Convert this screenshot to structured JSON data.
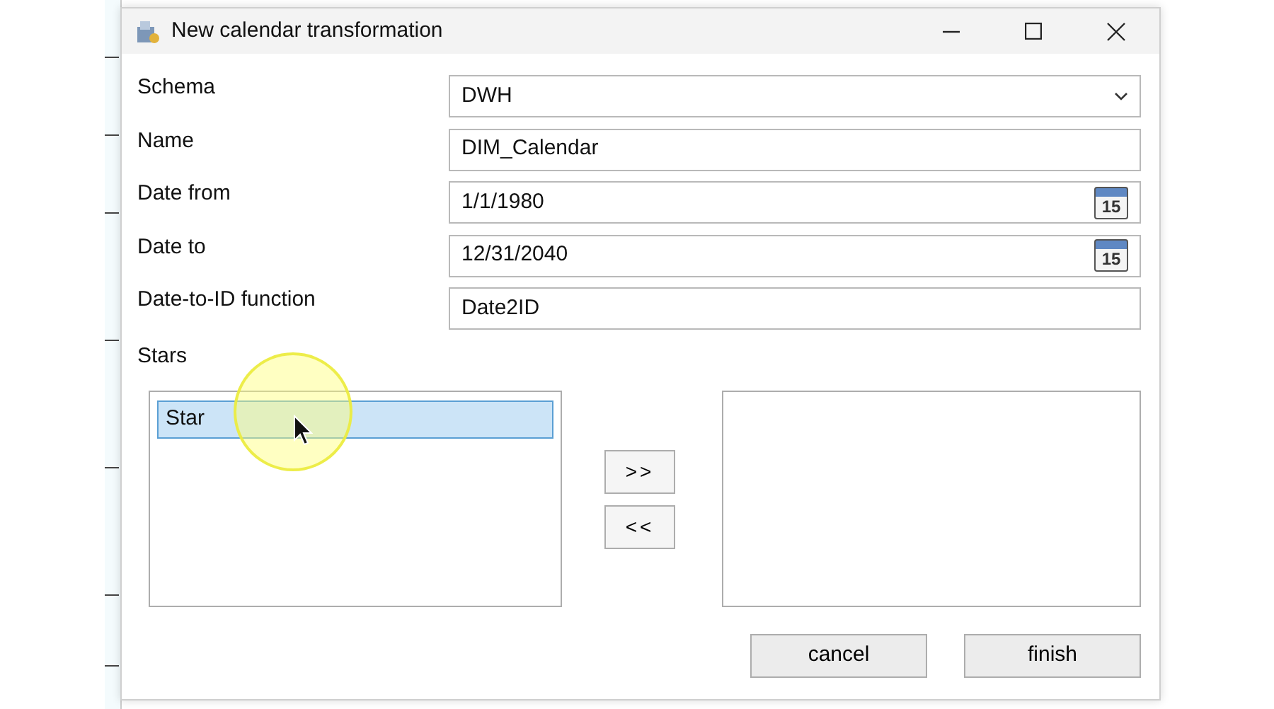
{
  "window": {
    "title": "New calendar transformation"
  },
  "fields": [
    {
      "label": "Schema",
      "kind": "dropdown",
      "value": "DWH"
    },
    {
      "label": "Name",
      "kind": "text",
      "value": "DIM_Calendar"
    },
    {
      "label": "Date from",
      "kind": "date",
      "value": "1/1/1980",
      "icon_text": "15"
    },
    {
      "label": "Date to",
      "kind": "date",
      "value": "12/31/2040",
      "icon_text": "15"
    },
    {
      "label": "Date-to-ID function",
      "kind": "text",
      "value": "Date2ID"
    }
  ],
  "stars": {
    "label": "Stars",
    "available": [
      {
        "text": "Star",
        "selected": true
      }
    ]
  },
  "move_buttons": [
    ">>",
    "<<"
  ],
  "buttons": [
    "cancel",
    "finish"
  ]
}
